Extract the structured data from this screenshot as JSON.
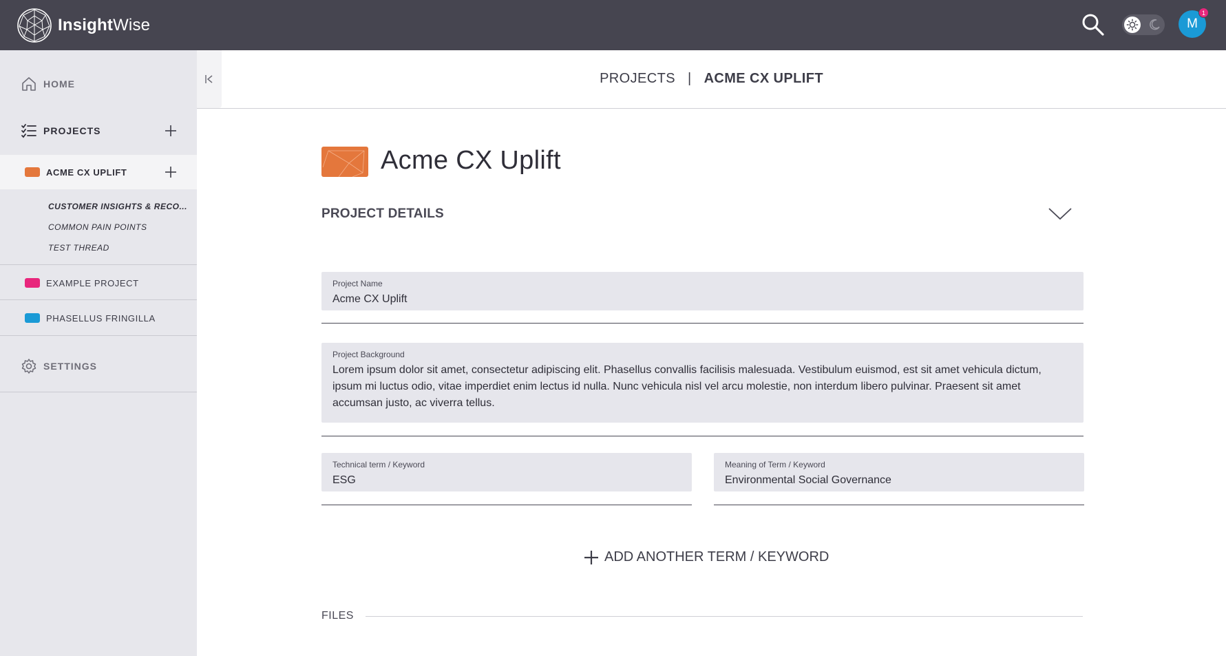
{
  "app": {
    "name_bold": "Insight",
    "name_light": "Wise"
  },
  "topbar": {
    "avatar_initial": "M",
    "notification_count": "1"
  },
  "sidebar": {
    "home_label": "HOME",
    "projects_label": "PROJECTS",
    "active_project": {
      "label": "ACME CX UPLIFT",
      "color": "#e4773c"
    },
    "threads": [
      "CUSTOMER INSIGHTS & RECO...",
      "COMMON PAIN POINTS",
      "TEST THREAD"
    ],
    "other_projects": [
      {
        "label": "EXAMPLE PROJECT",
        "color": "#e8267c"
      },
      {
        "label": "PHASELLUS FRINGILLA",
        "color": "#1a9ad6"
      }
    ],
    "settings_label": "SETTINGS"
  },
  "breadcrumb": {
    "parent": "PROJECTS",
    "separator": "|",
    "current": "ACME CX UPLIFT"
  },
  "main": {
    "title": "Acme CX Uplift",
    "section_title": "PROJECT DETAILS",
    "fields": {
      "project_name": {
        "label": "Project Name",
        "value": "Acme CX Uplift"
      },
      "project_background": {
        "label": "Project Background",
        "value": "Lorem ipsum dolor sit amet, consectetur adipiscing elit. Phasellus convallis facilisis malesuada. Vestibulum euismod, est sit amet vehicula dictum, ipsum mi luctus odio, vitae imperdiet enim lectus id nulla. Nunc vehicula nisl vel arcu molestie, non interdum libero pulvinar. Praesent sit amet accumsan justo, ac viverra tellus."
      },
      "term": {
        "label": "Technical term / Keyword",
        "value": "ESG"
      },
      "meaning": {
        "label": "Meaning of Term / Keyword",
        "value": "Environmental Social Governance"
      }
    },
    "add_term_label": "ADD ANOTHER TERM / KEYWORD",
    "files_label": "FILES"
  }
}
